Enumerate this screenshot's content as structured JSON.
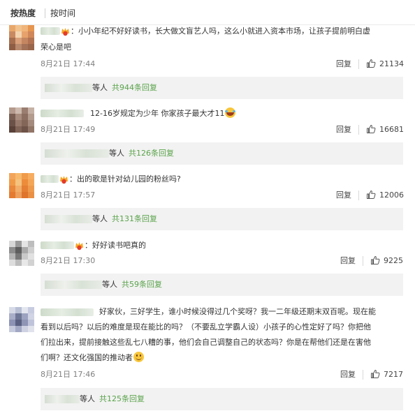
{
  "sort": {
    "hot_label": "按热度",
    "time_label": "按时间"
  },
  "comments": [
    {
      "text_line1": "：小小年纪不好好读书，长大做文盲艺人吗，这么小就进入资本市场，让孩子提前明白虚",
      "text_line2": "荣心是吧",
      "date": "8月21日 17:44",
      "reply_label": "回复",
      "likes": "21134",
      "sub_who": "等人",
      "sub_count": "共944条回复"
    },
    {
      "text_line1": "12-16岁规定为少年 你家孩子最大才11",
      "date": "8月21日 17:49",
      "reply_label": "回复",
      "likes": "16681",
      "sub_who": "等人",
      "sub_count": "共126条回复"
    },
    {
      "text_line1": "：出的歌是针对幼儿园的粉丝吗?",
      "date": "8月21日 17:57",
      "reply_label": "回复",
      "likes": "12006",
      "sub_who": "等人",
      "sub_count": "共131条回复"
    },
    {
      "text_line1": "：好好读书吧真的",
      "date": "8月21日 17:30",
      "reply_label": "回复",
      "likes": "9225",
      "sub_who": "等人",
      "sub_count": "共59条回复"
    },
    {
      "text_line1": "好家伙，三好学生，谁小时候没得过几个奖呀？我一二年级还期末双百呢。现在能",
      "text_line2": "看到以后吗？以后的难度是现在能比的吗？（不要乱立学霸人设）小孩子的心性定好了吗？你把他",
      "text_line3": "们拉出来，提前接触这些乱七八糟的事，他们会自己调整自己的状态吗？你是在帮他们还是在害他",
      "text_line4": "们啊？还文化强国的推动者",
      "date": "8月21日 17:46",
      "reply_label": "回复",
      "likes": "7217",
      "sub_who": "等人",
      "sub_count": "共125条回复"
    }
  ],
  "colors": {
    "reply_count_green": "#5aa34b",
    "gray_text": "#808080"
  }
}
